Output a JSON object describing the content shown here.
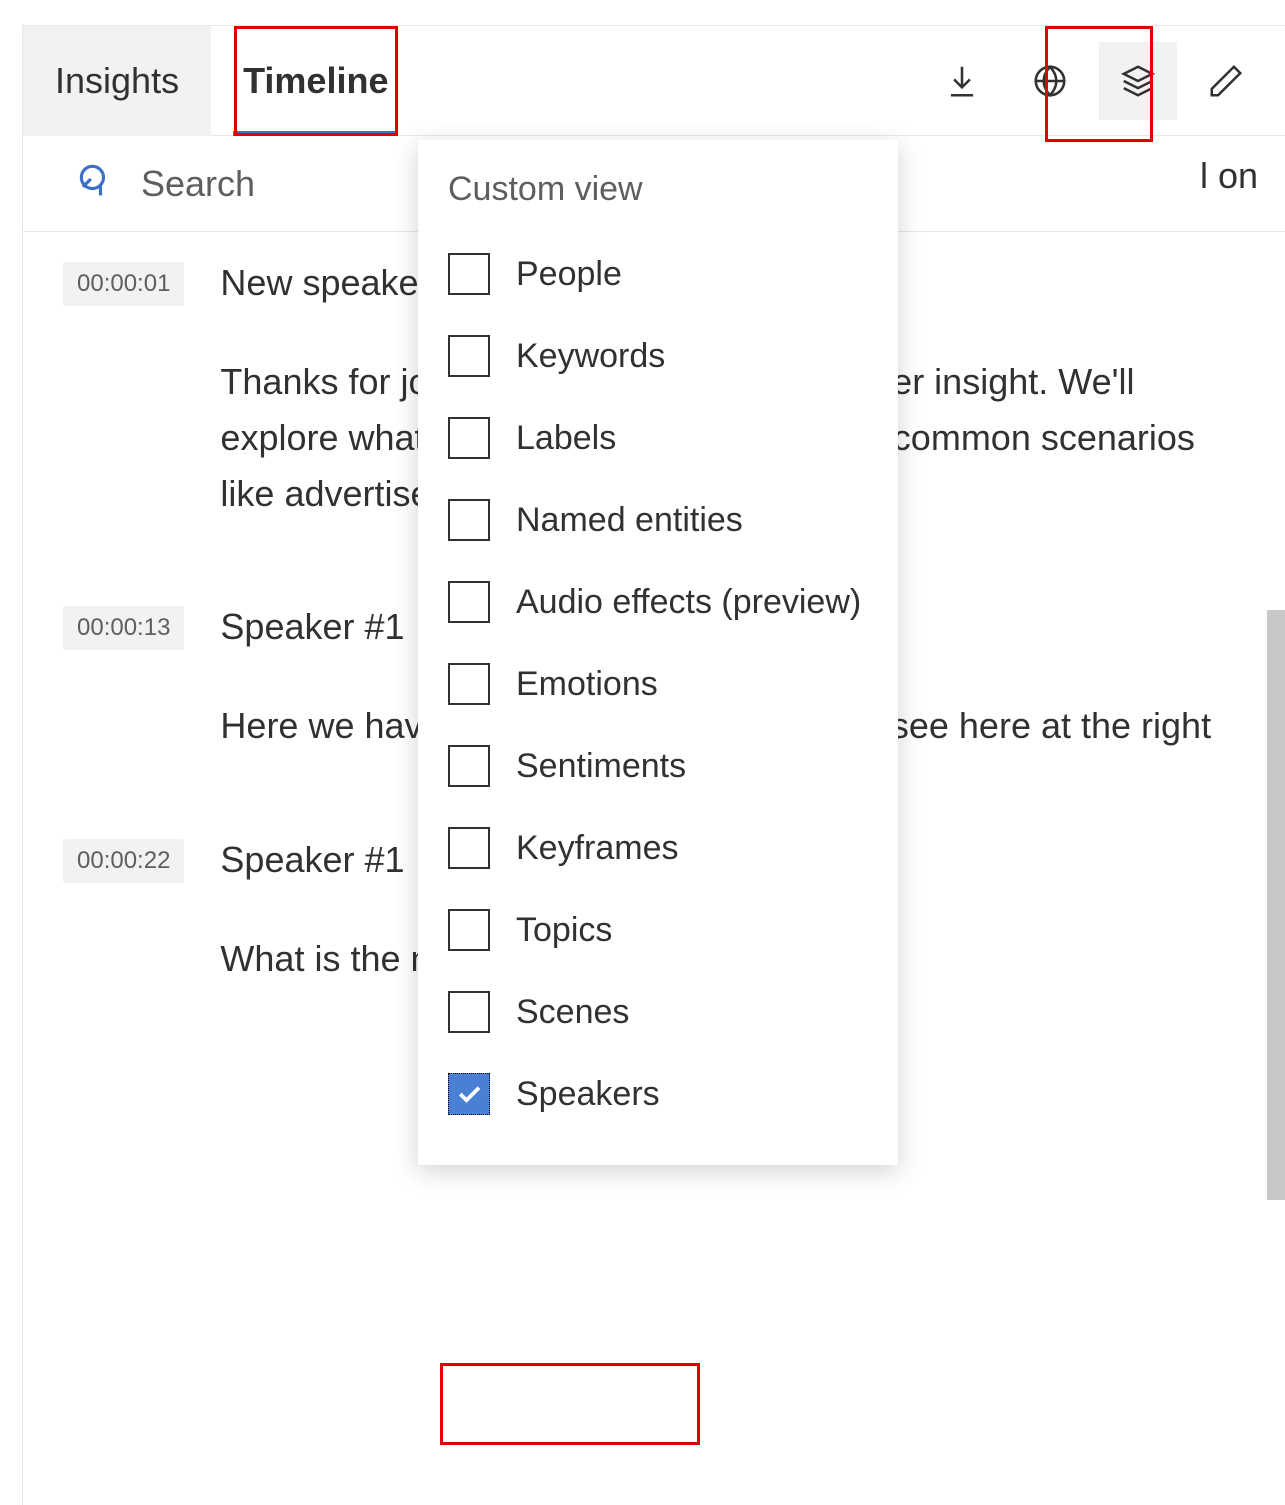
{
  "tabs": {
    "insights": "Insights",
    "timeline": "Timeline"
  },
  "search": {
    "placeholder": "Search"
  },
  "overflow_text": "l on",
  "entries": [
    {
      "time": "00:00:01",
      "speaker": "New speaker",
      "text": "Thanks for joining us at Azure Video indexer insight. We'll explore what it provides and walk through common scenarios like advertisement"
    },
    {
      "time": "00:00:13",
      "speaker": "Speaker #1",
      "text": "Here we have uploaded the video we can see here at the right"
    },
    {
      "time": "00:00:22",
      "speaker": "Speaker #1",
      "text": "What is the next step? This insight is"
    }
  ],
  "dropdown": {
    "title": "Custom view",
    "items": [
      {
        "label": "People",
        "checked": false
      },
      {
        "label": "Keywords",
        "checked": false
      },
      {
        "label": "Labels",
        "checked": false
      },
      {
        "label": "Named entities",
        "checked": false
      },
      {
        "label": "Audio effects (preview)",
        "checked": false
      },
      {
        "label": "Emotions",
        "checked": false
      },
      {
        "label": "Sentiments",
        "checked": false
      },
      {
        "label": "Keyframes",
        "checked": false
      },
      {
        "label": "Topics",
        "checked": false
      },
      {
        "label": "Scenes",
        "checked": false
      },
      {
        "label": "Speakers",
        "checked": true
      }
    ]
  }
}
